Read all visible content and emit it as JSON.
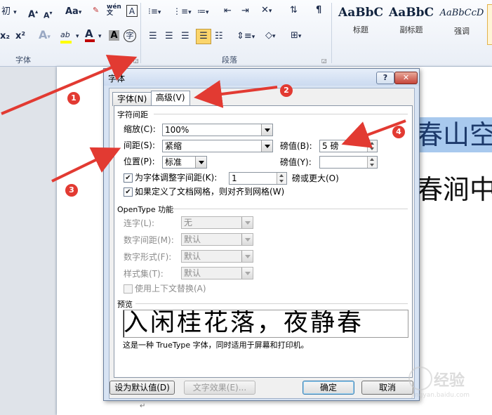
{
  "ribbon": {
    "font_name_fragment": "初",
    "font_group_label": "字体",
    "paragraph_group_label": "段落",
    "font_color_accent": "#c00000",
    "highlight_color": "#ffff00",
    "icons": [
      "grow-font-icon",
      "shrink-font-icon",
      "change-case-icon",
      "clear-format-icon",
      "phonetic-guide-icon",
      "char-border-icon",
      "subscript-icon",
      "superscript-icon",
      "text-effect-icon",
      "highlight-icon",
      "font-color-icon",
      "char-shading-icon",
      "enclose-char-icon",
      "bullets-icon",
      "numbering-icon",
      "multilevel-list-icon",
      "decrease-indent-icon",
      "increase-indent-icon",
      "asian-layout-icon",
      "sort-icon",
      "show-marks-icon",
      "align-left-icon",
      "center-icon",
      "align-right-icon",
      "justify-icon",
      "distributed-icon",
      "line-spacing-icon",
      "shading-icon",
      "borders-icon",
      "dialog-launcher-icon"
    ],
    "glyphs": {
      "grow": "A",
      "shrink": "A",
      "case": "Aa",
      "sub": "x₂",
      "sup": "x²",
      "effect": "A",
      "hl": "ab",
      "color": "A",
      "shade": "A",
      "enclose": "字",
      "phon": "wén",
      "border": "A"
    },
    "styles": [
      {
        "sample": "AaBbC",
        "caption": "标题"
      },
      {
        "sample": "AaBbC",
        "caption": "副标题"
      },
      {
        "sample": "AaBbCcD",
        "caption": "强调"
      }
    ]
  },
  "document": {
    "line1": "春山空",
    "line2": "春涧中",
    "selection_color": "#a8c9ee",
    "pilcrow": "↵"
  },
  "dialog": {
    "title": "字体",
    "help_button": "?",
    "close_button": "✕",
    "tabs": [
      {
        "label": "字体(N)",
        "active": false
      },
      {
        "label": "高级(V)",
        "active": true
      }
    ],
    "char_spacing": {
      "section_title": "字符间距",
      "scale_label": "缩放(C):",
      "scale_value": "100%",
      "spacing_label": "间距(S):",
      "spacing_value": "紧缩",
      "spacing_by_label": "磅值(B):",
      "spacing_by_value": "5 磅",
      "position_label": "位置(P):",
      "position_value": "标准",
      "position_by_label": "磅值(Y):",
      "position_by_value": "",
      "kerning_label": "为字体调整字间距(K):",
      "kerning_checked": true,
      "kerning_value": "1",
      "kerning_suffix": "磅或更大(O)",
      "grid_label": "如果定义了文档网格，则对齐到网格(W)",
      "grid_checked": true
    },
    "opentype": {
      "section_title": "OpenType 功能",
      "ligatures_label": "连字(L):",
      "ligatures_value": "无",
      "num_spacing_label": "数字间距(M):",
      "num_spacing_value": "默认",
      "num_forms_label": "数字形式(F):",
      "num_forms_value": "默认",
      "style_sets_label": "样式集(T):",
      "style_sets_value": "默认",
      "contextual_label": "使用上下文替换(A)",
      "contextual_checked": false
    },
    "preview": {
      "section_title": "预览",
      "sample_text": "入闲桂花落，夜静春",
      "note": "这是一种 TrueType 字体，同时适用于屏幕和打印机。"
    },
    "buttons": {
      "set_default": "设为默认值(D)",
      "text_effects": "文字效果(E)...",
      "ok": "确定",
      "cancel": "取消"
    }
  },
  "annotations": {
    "color": "#e23a32",
    "badges": [
      "1",
      "2",
      "3",
      "4"
    ]
  },
  "watermark": {
    "text": "经验",
    "subtext": "jingyan.baidu.com"
  }
}
